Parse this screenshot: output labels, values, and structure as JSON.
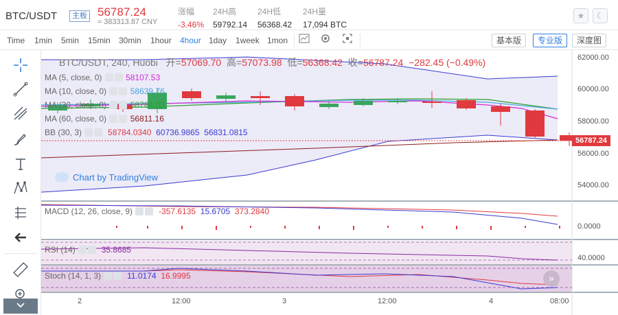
{
  "header": {
    "symbol": "BTC/USDT",
    "market_tag": "主板",
    "price": "56787.24",
    "cny_value": "≈ 383313.87 CNY",
    "stats": [
      {
        "label": "涨幅",
        "value": "-3.46%",
        "color": "#e0393e"
      },
      {
        "label": "24H高",
        "value": "59792.14",
        "color": "#333333"
      },
      {
        "label": "24H低",
        "value": "56368.42",
        "color": "#333333"
      },
      {
        "label": "24H量",
        "value": "17,094 BTC",
        "color": "#333333"
      }
    ],
    "buttons": {
      "favorite": "★",
      "theme": "☾"
    }
  },
  "toolbar": {
    "timeframes": [
      "Time",
      "1min",
      "5min",
      "15min",
      "30min",
      "1hour",
      "4hour",
      "1day",
      "1week",
      "1mon"
    ],
    "active_timeframe": "4hour",
    "views": [
      "基本版",
      "专业版",
      "深度图"
    ],
    "active_view": "专业版"
  },
  "chart": {
    "ohlc": {
      "title": "BTC/USDT, 240, Huobi",
      "open_label": "开=",
      "open": "57069.70",
      "high_label": "高=",
      "high": "57073.98",
      "low_label": "低=",
      "low": "56368.42",
      "close_label": "收=",
      "close": "56787.24",
      "change": "−282.45 (−0.49%)"
    },
    "indicators": [
      {
        "name": "MA (5, close, 0)",
        "value": "58107.53",
        "color": "#d12bd1"
      },
      {
        "name": "MA (10, close, 0)",
        "value": "58639.76",
        "color": "#4aa3e0"
      },
      {
        "name": "MA (30, close, 0)",
        "value": "58784.03",
        "color": "#2ca02c"
      },
      {
        "name": "MA (60, close, 0)",
        "value": "56811.16",
        "color": "#8a1a1a"
      },
      {
        "name": "BB (30, 3)",
        "values": [
          "58784.0340",
          "60736.9865",
          "56831.0815"
        ],
        "colors": [
          "#e0393e",
          "#3a3ad0",
          "#3a3ad0"
        ]
      }
    ],
    "watermark": "Chart by TradingView",
    "price_axis": [
      "62000.00",
      "60000.00",
      "58000.00",
      "56000.00",
      "54000.00",
      "0.0000",
      "40.0000"
    ],
    "current_price_label": "56787.24",
    "time_axis": [
      "2",
      "12:00",
      "3",
      "12:00",
      "4",
      "08:00"
    ],
    "macd": {
      "name": "MACD (12, 26, close, 9)",
      "values": [
        "-357.6135",
        "15.6705",
        "373.2840"
      ],
      "colors": [
        "#e0393e",
        "#3a3ad0",
        "#e0393e"
      ]
    },
    "rsi": {
      "name": "RSI (14)",
      "value": "35.8685",
      "color": "#8a2aa0"
    },
    "stoch": {
      "name": "Stoch (14, 1, 3)",
      "values": [
        "11.0174",
        "16.9995"
      ],
      "colors": [
        "#3a3ad0",
        "#e0393e"
      ]
    },
    "scroll_button": "»"
  },
  "colors": {
    "up": "#3aa55d",
    "down": "#e0393e",
    "accent": "#2f7fe0"
  }
}
